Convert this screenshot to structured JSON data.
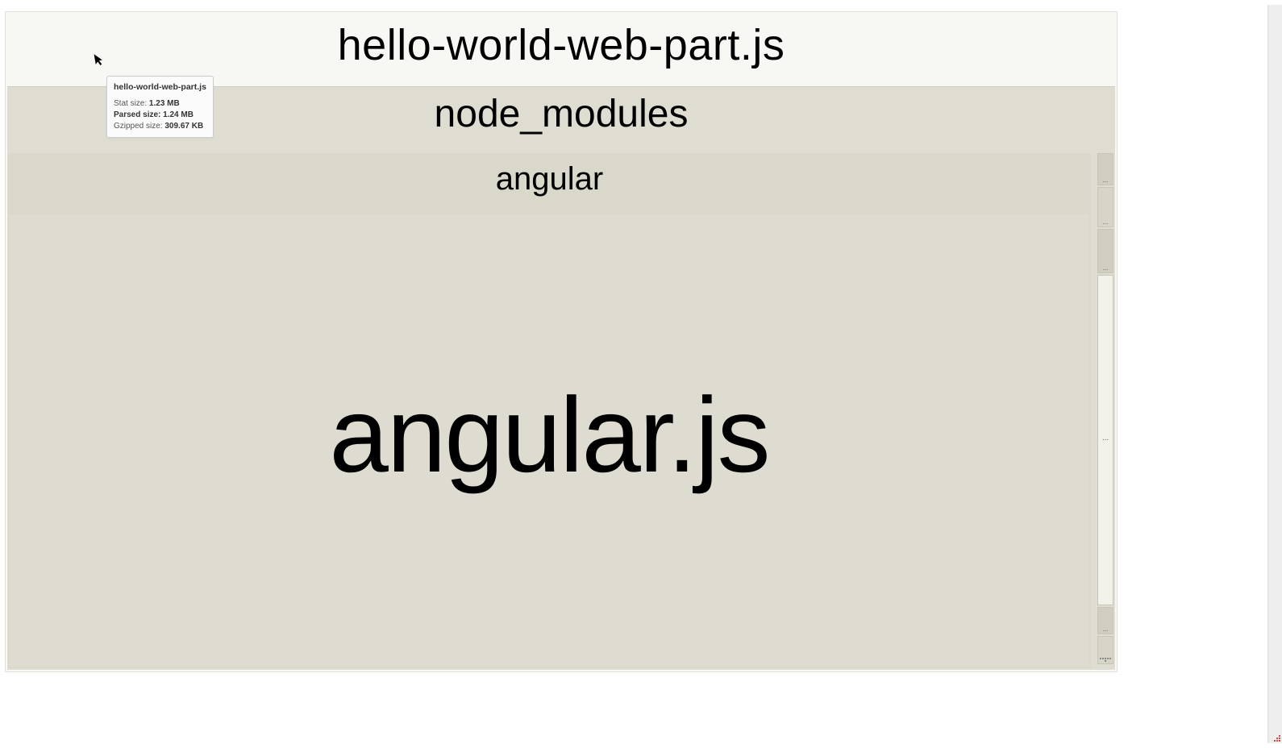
{
  "bundle": {
    "name": "hello-world-web-part.js",
    "children": {
      "node_modules": {
        "label": "node_modules",
        "children": {
          "angular": {
            "label": "angular",
            "children": {
              "angular_js": {
                "label": "angular.js"
              }
            }
          }
        }
      }
    }
  },
  "tooltip": {
    "title": "hello-world-web-part.js",
    "stat_label": "Stat size:",
    "stat_value": "1.23 MB",
    "parsed_label": "Parsed size:",
    "parsed_value": "1.24 MB",
    "gzip_label": "Gzipped size:",
    "gzip_value": "309.67 KB"
  },
  "small_blocks": {
    "ellipsis": "..."
  }
}
